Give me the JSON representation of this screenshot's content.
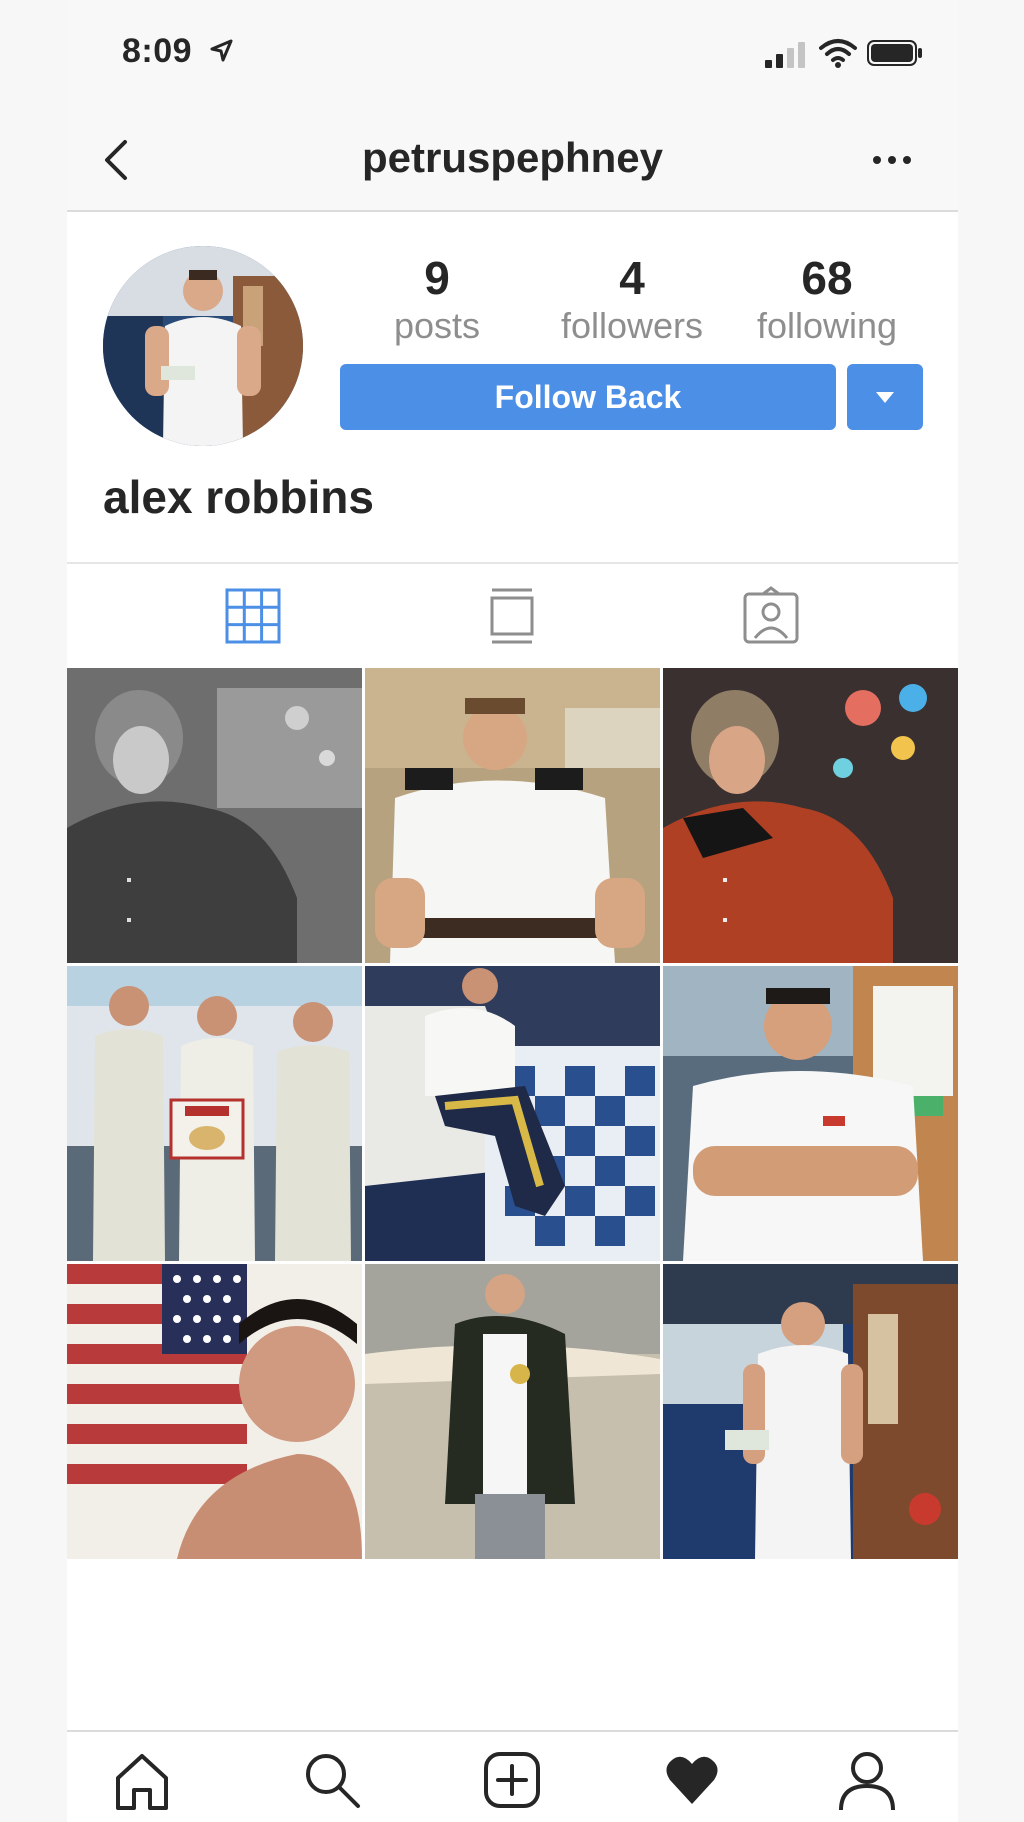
{
  "status_bar": {
    "time": "8:09"
  },
  "header": {
    "username": "petruspephney"
  },
  "profile": {
    "posts_count": "9",
    "posts_label": "posts",
    "followers_count": "4",
    "followers_label": "followers",
    "following_count": "68",
    "following_label": "following",
    "follow_button_label": "Follow Back",
    "full_name": "alex robbins"
  },
  "tabs": [
    {
      "name": "grid-view",
      "active": true
    },
    {
      "name": "feed-view",
      "active": false
    },
    {
      "name": "tagged-view",
      "active": false
    }
  ],
  "colors": {
    "accent": "#4c8fe6",
    "muted": "#8e8e8e",
    "text": "#262626"
  },
  "bottom_nav": [
    "home-icon",
    "search-icon",
    "add-post-icon",
    "activity-heart-icon",
    "profile-icon"
  ]
}
